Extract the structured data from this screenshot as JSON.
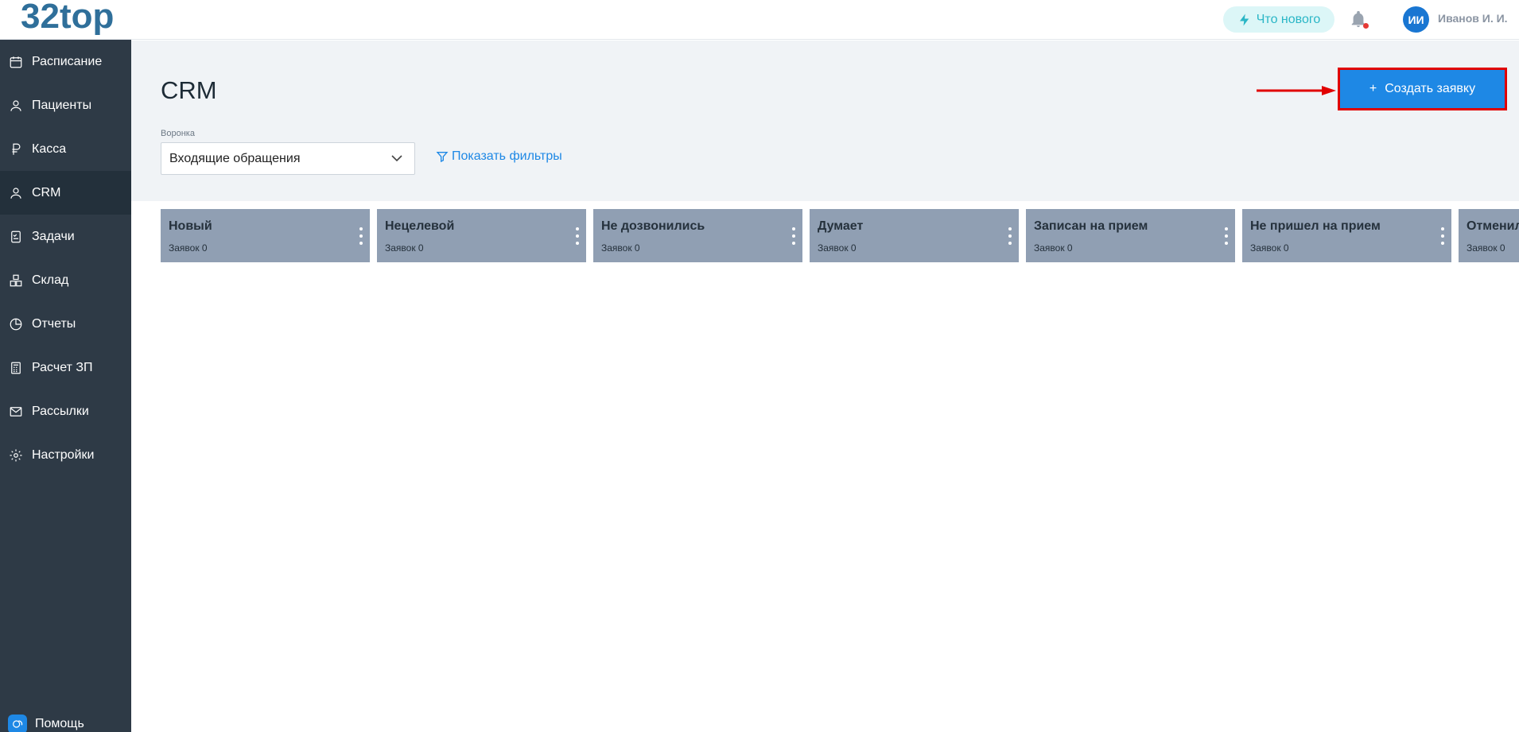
{
  "header": {
    "logo": "32top",
    "whats_new": "Что нового",
    "avatar_initials": "ИИ",
    "user_name": "Иванов И. И."
  },
  "sidebar": {
    "items": [
      {
        "label": "Расписание",
        "icon": "calendar-icon"
      },
      {
        "label": "Пациенты",
        "icon": "user-icon"
      },
      {
        "label": "Касса",
        "icon": "ruble-icon"
      },
      {
        "label": "CRM",
        "icon": "user-icon",
        "active": true
      },
      {
        "label": "Задачи",
        "icon": "checklist-icon"
      },
      {
        "label": "Склад",
        "icon": "boxes-icon"
      },
      {
        "label": "Отчеты",
        "icon": "pie-chart-icon"
      },
      {
        "label": "Расчет ЗП",
        "icon": "calculator-icon"
      },
      {
        "label": "Рассылки",
        "icon": "mail-icon"
      },
      {
        "label": "Настройки",
        "icon": "gear-icon"
      }
    ],
    "help": "Помощь"
  },
  "main": {
    "title": "CRM",
    "create_button": "Создать заявку",
    "create_plus": "+",
    "funnel_label": "Воронка",
    "funnel_value": "Входящие обращения",
    "show_filters": "Показать фильтры",
    "columns": [
      {
        "title": "Новый",
        "count": "Заявок 0"
      },
      {
        "title": "Нецелевой",
        "count": "Заявок 0"
      },
      {
        "title": "Не дозвонились",
        "count": "Заявок 0"
      },
      {
        "title": "Думает",
        "count": "Заявок 0"
      },
      {
        "title": "Записан на прием",
        "count": "Заявок 0"
      },
      {
        "title": "Не пришел на прием",
        "count": "Заявок 0"
      },
      {
        "title": "Отменил",
        "count": "Заявок 0"
      }
    ]
  },
  "colors": {
    "sidebar_bg": "#2e3a46",
    "accent": "#1e88e5",
    "column_bg": "#909fb3",
    "highlight": "#e10000"
  }
}
